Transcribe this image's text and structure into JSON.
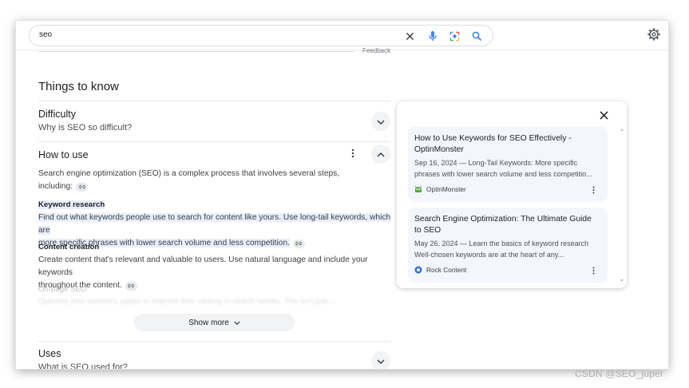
{
  "search": {
    "query": "seo",
    "feedback": "Feedback"
  },
  "things_to_know": {
    "title": "Things to know",
    "topics": [
      {
        "title": "Difficulty",
        "subtitle": "Why is SEO so difficult?"
      },
      {
        "title": "How to use"
      },
      {
        "title": "Uses",
        "subtitle": "What is SEO used for?"
      }
    ],
    "how_to_use": {
      "intro_line1": "Search engine optimization (SEO) is a complex process that involves several steps,",
      "intro_line2": "including:",
      "keyword_heading": "Keyword research",
      "keyword_line1": "Find out what keywords people use to search for content like yours. Use long-tail keywords, which are",
      "keyword_line2": "more specific phrases with lower search volume and less competition.",
      "content_heading": "Content creation",
      "content_line1": "Create content that's relevant and valuable to users. Use natural language and include your keywords",
      "content_line2": "throughout the content.",
      "onpage_heading": "On-page SEO",
      "onpage_line": "Optimize your website's pages to improve their ranking in search results. This isn't just..."
    },
    "show_more": "Show more"
  },
  "side_panel": {
    "cards": [
      {
        "title": "How to Use Keywords for SEO Effectively - OptinMonster",
        "snippet_line1": "Sep 16, 2024 — Long-Tail Keywords: More specific",
        "snippet_line2": "phrases with lower search volume and less competitio...",
        "source": "OptinMonster"
      },
      {
        "title": "Search Engine Optimization: The Ultimate Guide to SEO",
        "snippet_line1": "May 26, 2024 — Learn the basics of keyword research",
        "snippet_line2": "Well-chosen keywords are at the heart of any...",
        "source": "Rock Content"
      }
    ]
  },
  "watermark": "CSDN @SEO_juper",
  "colors": {
    "highlight": "#e8eefb",
    "card_bg": "#f3f6fc",
    "google_blue": "#4285f4",
    "optinmonster_green": "#5ba946",
    "rockcontent_blue": "#2f6fe4"
  }
}
